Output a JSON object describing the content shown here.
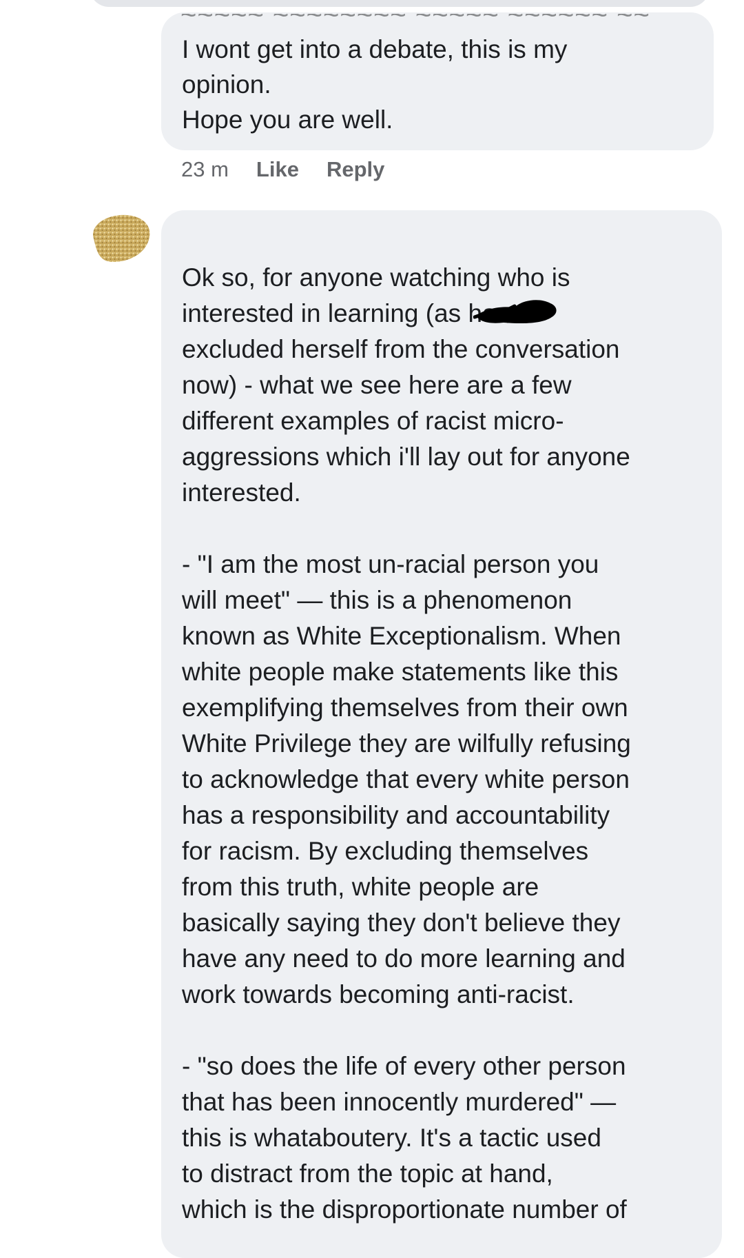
{
  "comments": [
    {
      "text": "I wont get into a debate, this is my\nopinion.\nHope you are well.",
      "time": "23 m",
      "like_label": "Like",
      "reply_label": "Reply"
    },
    {
      "author_redacted": true,
      "paragraphs": [
        "Ok so, for anyone watching who is\ninterested in learning (as           has\nexcluded herself from the conversation\nnow) - what we see here are a few\ndifferent examples of racist micro-\naggressions which i'll lay out for anyone\ninterested.",
        "- \"I am the most un-racial person you\nwill meet\" — this is a phenomenon\nknown as White Exceptionalism. When\nwhite people make statements like this\nexemplifying themselves from their own\nWhite Privilege they are wilfully refusing\nto acknowledge that every white person\nhas a responsibility and accountability\nfor racism. By excluding themselves\nfrom this truth, white people are\nbasically saying they don't believe they\nhave any need to do more learning and\nwork towards becoming anti-racist.",
        "- \"so does the life of every other person\nthat has been innocently murdered\" —\nthis is whataboutery. It's a tactic used\nto distract from the topic at hand,\nwhich is the disproportionate number of"
      ]
    }
  ],
  "colors": {
    "bubble": "#eef0f3",
    "meta_text": "#65676b",
    "body_text": "#1c1e21",
    "avatar_redaction": "#c8a85a",
    "scribble": "#000000"
  },
  "icons": {
    "avatar": "redacted-avatar-icon",
    "name": "redacted-name-icon",
    "scribble": "redaction-scribble-icon"
  }
}
